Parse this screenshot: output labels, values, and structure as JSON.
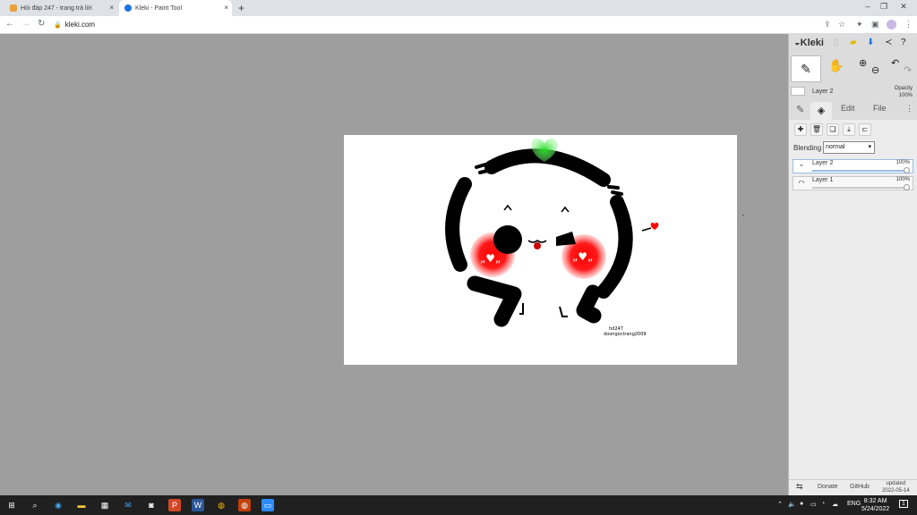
{
  "browser": {
    "tabs": [
      {
        "title": "Hỏi đáp 247 - trang trả lời",
        "favicon": "hoidap-favicon",
        "active": false
      },
      {
        "title": "Kleki - Paint Tool",
        "favicon": "kleki-favicon",
        "active": true
      }
    ],
    "new_tab": "+",
    "close_tab": "×",
    "url": "kleki.com",
    "window_controls": [
      "–",
      "❐",
      "✕"
    ]
  },
  "app": {
    "logo": "Kleki",
    "active_layer": {
      "name": "Layer 2",
      "opacity_label": "Opacity",
      "opacity_value": "100%"
    },
    "tabs": [
      {
        "label": "Edit"
      },
      {
        "label": "File"
      }
    ],
    "blending": {
      "label": "Blending",
      "value": "normal"
    },
    "layers": [
      {
        "name": "Layer 2",
        "opacity": "100%",
        "selected": true
      },
      {
        "name": "Layer 1",
        "opacity": "100%",
        "selected": false
      }
    ],
    "footer": {
      "donate": "Donate",
      "github": "GitHub",
      "updated_label": "updated",
      "updated_date": "2022-05-14"
    }
  },
  "canvas_art": {
    "signature_line1": "hd247",
    "signature_line2": "doongoctrang2009"
  },
  "taskbar": {
    "lang": "ENG",
    "time": "8:32 AM",
    "date": "5/24/2022",
    "notif_count": "1"
  },
  "colors": {
    "accent": "#1a73e8",
    "heart_green": "#22dd22",
    "blush_red": "#ff0000"
  }
}
